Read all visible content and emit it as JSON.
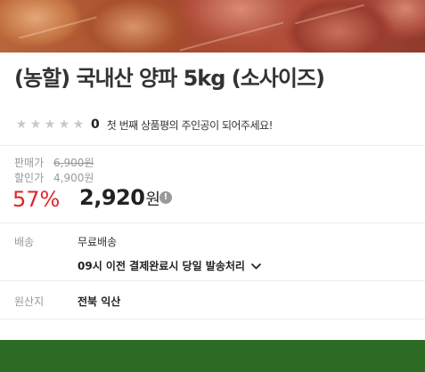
{
  "product": {
    "title": "(농할) 국내산 양파 5kg (소사이즈)",
    "image_icon": "onion-photo"
  },
  "rating": {
    "stars_filled": 0,
    "stars_total": 5,
    "count": "0",
    "cta": "첫 번째 상품평의 주인공이 되어주세요!"
  },
  "price": {
    "sale_label": "판매가",
    "sale_value": "6,900원",
    "discount_label": "할인가",
    "discount_value": "4,900원",
    "rate": "57%",
    "final_number": "2,920",
    "final_unit": "원",
    "info_icon": "info-icon"
  },
  "shipping": {
    "label": "배송",
    "method": "무료배송",
    "schedule": "09시 이전 결제완료시 당일 발송처리"
  },
  "origin": {
    "label": "원산지",
    "value": "전북 익산"
  },
  "colors": {
    "accent_red": "#e0252c",
    "footer_green": "#2b6b23"
  }
}
